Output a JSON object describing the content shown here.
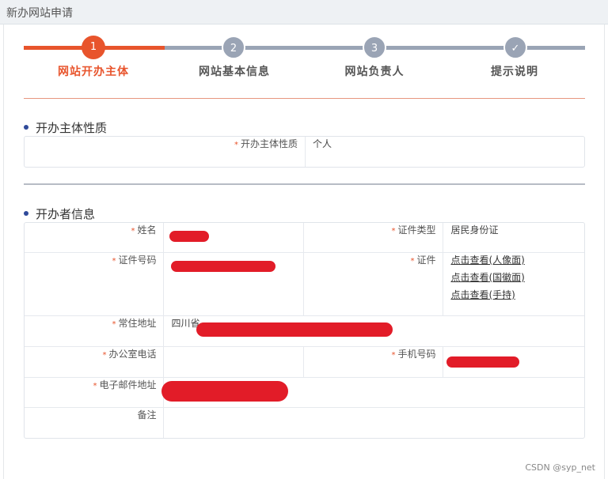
{
  "header": {
    "title": "新办网站申请"
  },
  "steps": [
    {
      "number": "1",
      "label": "网站开办主体",
      "state": "active"
    },
    {
      "number": "2",
      "label": "网站基本信息",
      "state": "idle"
    },
    {
      "number": "3",
      "label": "网站负责人",
      "state": "idle"
    },
    {
      "number": "✓",
      "label": "提示说明",
      "state": "idle"
    }
  ],
  "colors": {
    "accent": "#e8542c",
    "step_idle": "#9aa4b5",
    "redaction": "#e0101c",
    "section_dot": "#2f4a9a"
  },
  "section1": {
    "title": "开办主体性质",
    "nature_label": "开办主体性质",
    "nature_value": "个人"
  },
  "section2": {
    "title": "开办者信息",
    "name_label": "姓名",
    "cert_type_label": "证件类型",
    "cert_type_value": "居民身份证",
    "cert_no_label": "证件号码",
    "cert_label": "证件",
    "cert_links": [
      "点击查看(人像面)",
      "点击查看(国徽面)",
      "点击查看(手持)"
    ],
    "address_label": "常住地址",
    "address_value": "四川省",
    "office_phone_label": "办公室电话",
    "mobile_label": "手机号码",
    "email_label": "电子邮件地址",
    "remark_label": "备注"
  },
  "watermark": "CSDN @syp_net"
}
